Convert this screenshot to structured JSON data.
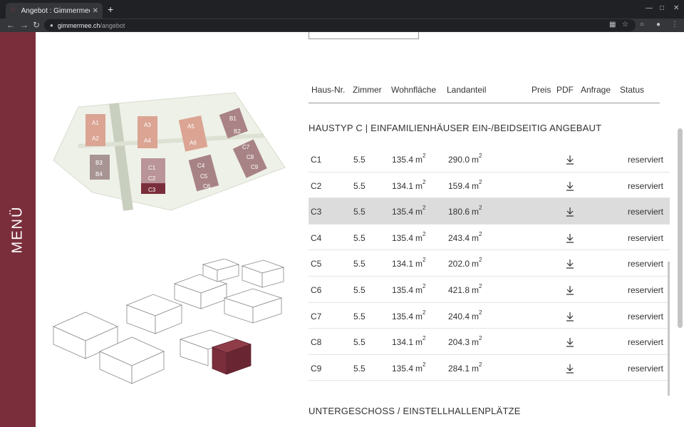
{
  "browser": {
    "tab_title": "Angebot : Gimmermee : U",
    "new_tab": "+",
    "url_domain": "gimmermee.ch",
    "url_path": "/angebot"
  },
  "menu": {
    "label": "MENÜ"
  },
  "table": {
    "headers": [
      "Haus-Nr.",
      "Zimmer",
      "Wohnfläche",
      "Landanteil",
      "Preis",
      "PDF",
      "Anfrage",
      "Status"
    ],
    "section_title": "HAUSTYP C | EINFAMILIENHÄUSER EIN-/BEIDSEITIG ANGEBAUT",
    "unit_sq": "m",
    "unit_exp": "2",
    "rows": [
      {
        "nr": "C1",
        "zimmer": "5.5",
        "wohn": "135.4",
        "land": "290.0",
        "status": "reserviert"
      },
      {
        "nr": "C2",
        "zimmer": "5.5",
        "wohn": "134.1",
        "land": "159.4",
        "status": "reserviert"
      },
      {
        "nr": "C3",
        "zimmer": "5.5",
        "wohn": "135.4",
        "land": "180.6",
        "status": "reserviert"
      },
      {
        "nr": "C4",
        "zimmer": "5.5",
        "wohn": "135.4",
        "land": "243.4",
        "status": "reserviert"
      },
      {
        "nr": "C5",
        "zimmer": "5.5",
        "wohn": "134.1",
        "land": "202.0",
        "status": "reserviert"
      },
      {
        "nr": "C6",
        "zimmer": "5.5",
        "wohn": "135.4",
        "land": "421.8",
        "status": "reserviert"
      },
      {
        "nr": "C7",
        "zimmer": "5.5",
        "wohn": "135.4",
        "land": "240.4",
        "status": "reserviert"
      },
      {
        "nr": "C8",
        "zimmer": "5.5",
        "wohn": "134.1",
        "land": "204.3",
        "status": "reserviert"
      },
      {
        "nr": "C9",
        "zimmer": "5.5",
        "wohn": "135.4",
        "land": "284.1",
        "status": "reserviert"
      }
    ],
    "next_section_title": "UNTERGESCHOSS / EINSTELLHALLENPLÄTZE"
  },
  "siteplan": {
    "labels": [
      "A1",
      "A2",
      "A3",
      "A4",
      "A5",
      "A6",
      "B1",
      "B2",
      "B3",
      "B4",
      "C1",
      "C2",
      "C3",
      "C4",
      "C5",
      "C6",
      "C7",
      "C8",
      "C9"
    ],
    "selected": "C3"
  },
  "colors": {
    "accent": "#7a2e3c",
    "highlight_row": "#dcdcdc"
  }
}
